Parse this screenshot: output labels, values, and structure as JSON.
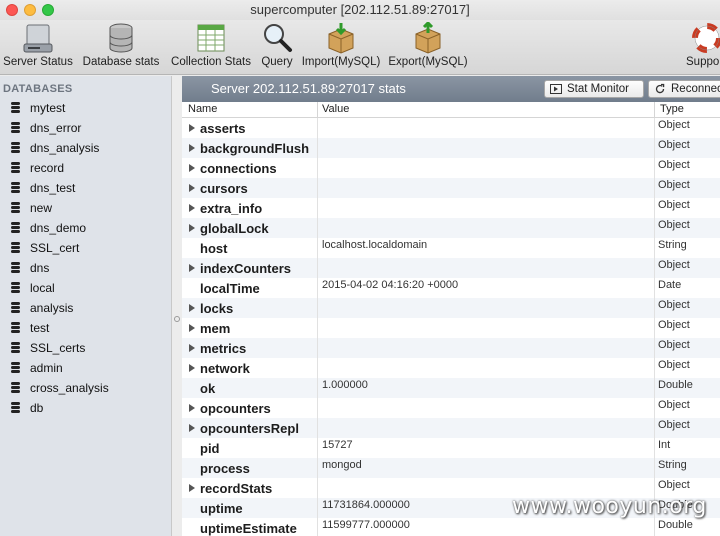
{
  "window": {
    "title": "supercomputer [202.112.51.89:27017]"
  },
  "toolbar": {
    "items": [
      {
        "label": "Server Status",
        "icon": "hard-drive-icon"
      },
      {
        "label": "Database stats",
        "icon": "database-icon"
      },
      {
        "label": "Collection Stats",
        "icon": "spreadsheet-icon"
      },
      {
        "label": "Query",
        "icon": "magnifier-icon"
      },
      {
        "label": "Import(MySQL)",
        "icon": "box-import-icon"
      },
      {
        "label": "Export(MySQL)",
        "icon": "box-export-icon"
      },
      {
        "label": "Suppo",
        "icon": "lifebuoy-icon"
      }
    ]
  },
  "sidebar": {
    "header": "DATABASES",
    "items": [
      "mytest",
      "dns_error",
      "dns_analysis",
      "record",
      "dns_test",
      "new",
      "dns_demo",
      "SSL_cert",
      "dns",
      "local",
      "analysis",
      "test",
      "SSL_certs",
      "admin",
      "cross_analysis",
      "db"
    ]
  },
  "main": {
    "title": "Server 202.112.51.89:27017 stats",
    "stat_monitor_label": "Stat Monitor",
    "reconnect_label": "Reconnect",
    "columns": {
      "name": "Name",
      "value": "Value",
      "type": "Type"
    },
    "rows": [
      {
        "name": "asserts",
        "value": "",
        "type": "Object",
        "expandable": true
      },
      {
        "name": "backgroundFlush",
        "value": "",
        "type": "Object",
        "expandable": true
      },
      {
        "name": "connections",
        "value": "",
        "type": "Object",
        "expandable": true
      },
      {
        "name": "cursors",
        "value": "",
        "type": "Object",
        "expandable": true
      },
      {
        "name": "extra_info",
        "value": "",
        "type": "Object",
        "expandable": true
      },
      {
        "name": "globalLock",
        "value": "",
        "type": "Object",
        "expandable": true
      },
      {
        "name": "host",
        "value": "localhost.localdomain",
        "type": "String",
        "expandable": false
      },
      {
        "name": "indexCounters",
        "value": "",
        "type": "Object",
        "expandable": true
      },
      {
        "name": "localTime",
        "value": "2015-04-02 04:16:20 +0000",
        "type": "Date",
        "expandable": false
      },
      {
        "name": "locks",
        "value": "",
        "type": "Object",
        "expandable": true
      },
      {
        "name": "mem",
        "value": "",
        "type": "Object",
        "expandable": true
      },
      {
        "name": "metrics",
        "value": "",
        "type": "Object",
        "expandable": true
      },
      {
        "name": "network",
        "value": "",
        "type": "Object",
        "expandable": true
      },
      {
        "name": "ok",
        "value": "1.000000",
        "type": "Double",
        "expandable": false
      },
      {
        "name": "opcounters",
        "value": "",
        "type": "Object",
        "expandable": true
      },
      {
        "name": "opcountersRepl",
        "value": "",
        "type": "Object",
        "expandable": true
      },
      {
        "name": "pid",
        "value": "15727",
        "type": "Int",
        "expandable": false
      },
      {
        "name": "process",
        "value": "mongod",
        "type": "String",
        "expandable": false
      },
      {
        "name": "recordStats",
        "value": "",
        "type": "Object",
        "expandable": true
      },
      {
        "name": "uptime",
        "value": "11731864.000000",
        "type": "Double",
        "expandable": false
      },
      {
        "name": "uptimeEstimate",
        "value": "11599777.000000",
        "type": "Double",
        "expandable": false
      }
    ]
  },
  "watermark": "www.wooyun.org"
}
